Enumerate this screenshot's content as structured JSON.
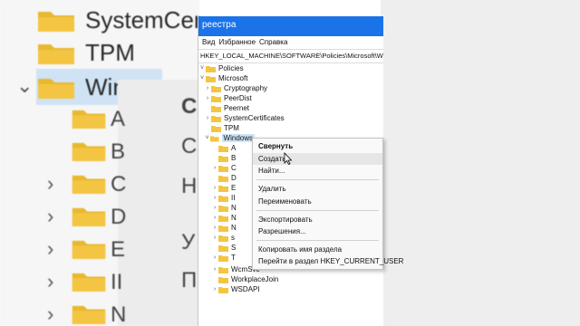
{
  "window": {
    "title": "реестра",
    "menu": [
      "Вид",
      "Избранное",
      "Справка"
    ],
    "address": "HKEY_LOCAL_MACHINE\\SOFTWARE\\Policies\\Microsoft\\Windows"
  },
  "background": {
    "items": [
      "SystemCertific",
      "TPM",
      "Win"
    ],
    "side_letters": [
      "A",
      "B",
      "C",
      "D",
      "E",
      "II",
      "N"
    ],
    "right_letters": [
      "С",
      "С",
      "Н",
      "У",
      "П"
    ]
  },
  "tree": {
    "root": "Policies",
    "parent": "Microsoft",
    "children": [
      "Cryptography",
      "PeerDist",
      "Peernet",
      "SystemCertificates",
      "TPM",
      "Windows"
    ],
    "sub_hidden": [
      "А",
      "В",
      "С",
      "D",
      "E",
      "II",
      "N",
      "N",
      "N",
      "s",
      "S",
      "T"
    ],
    "tail": [
      "WcmSvc",
      "WorkplaceJoin",
      "WSDAPI"
    ]
  },
  "context_menu": {
    "collapse": "Свернуть",
    "create": "Создать",
    "find": "Найти...",
    "delete": "Удалить",
    "rename": "Переименовать",
    "export": "Экспортировать",
    "permissions": "Разрешения...",
    "copy_key_name": "Копировать имя раздела",
    "goto_hkcu": "Перейти в раздел HKEY_CURRENT_USER"
  },
  "colors": {
    "title_blue": "#1a73e8",
    "folder_yellow": "#f4c542",
    "selection": "#cce4f7"
  }
}
